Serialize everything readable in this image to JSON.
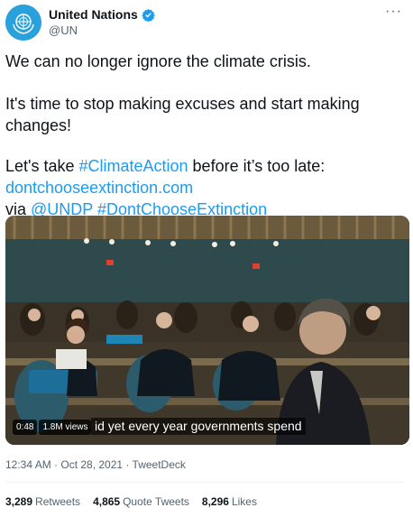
{
  "account": {
    "display_name": "United Nations",
    "handle": "@UN",
    "verified": true
  },
  "icons": [
    "un-logo-icon",
    "verified-badge-icon",
    "more-options-icon"
  ],
  "tweet": {
    "line1": "We can no longer ignore the climate crisis.",
    "line2": "It's time to stop making excuses and start making changes!",
    "line3_prefix": "Let's take ",
    "hashtag_climate": "#ClimateAction",
    "line3_suffix": " before it’s too late:",
    "link_url": "dontchooseextinction.com",
    "via_prefix": "via ",
    "mention_undp": "@UNDP",
    "hashtag_extinction": "#DontChooseExtinction"
  },
  "video": {
    "duration": "0:48",
    "views": "1.8M views",
    "subtitle": "id yet every year governments spend"
  },
  "meta": {
    "timestamp": "12:34 AM · Oct 28, 2021 · TweetDeck"
  },
  "stats": {
    "retweets_count": "3,289",
    "retweets_label": "Retweets",
    "quote_count": "4,865",
    "quote_label": "Quote Tweets",
    "likes_count": "8,296",
    "likes_label": "Likes"
  },
  "colors": {
    "link": "#1d9bf0",
    "avatar_bg": "#2ba1db",
    "verified": "#1d9bf0",
    "secondary_text": "#536471"
  }
}
